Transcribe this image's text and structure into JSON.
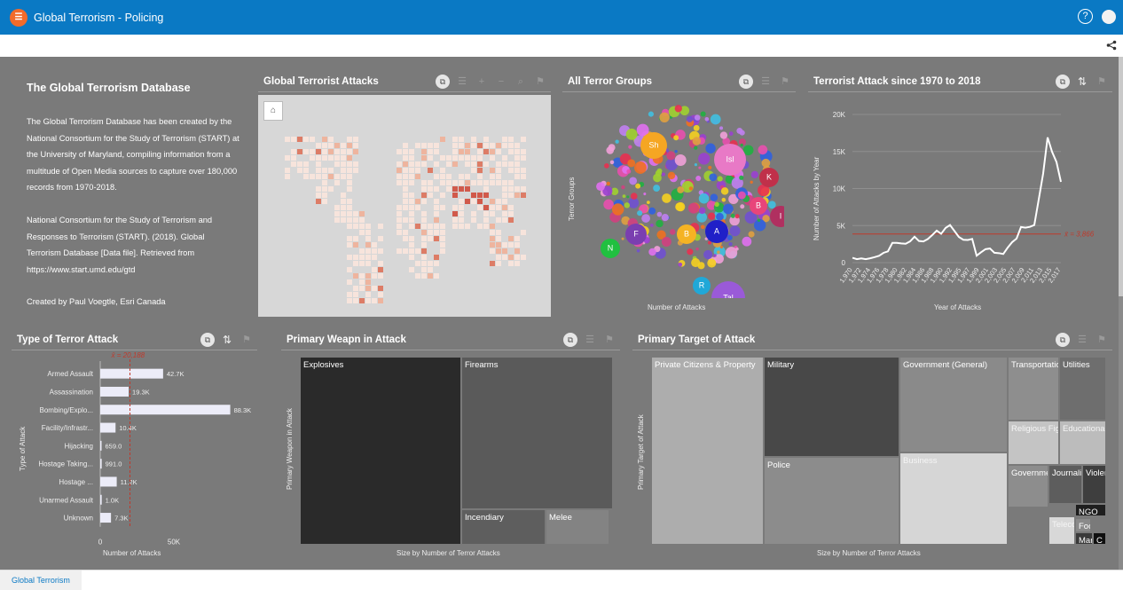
{
  "header": {
    "title": "Global Terrorism - Policing",
    "help": "?"
  },
  "intro": {
    "heading": "The Global Terrorism Database",
    "para1": "The Global Terrorism Database has been created by the National Consortium for the Study of Terrorism (START) at the University of Maryland, compiling information from a multitude of Open Media sources to capture over 180,000 records from 1970-2018.",
    "para2": "National Consortium for the Study of Terrorism and Responses to Terrorism (START). (2018). Global Terrorism Database [Data file]. Retrieved from https://www.start.umd.edu/gtd",
    "para3": "Created by Paul Voegtle, Esri Canada"
  },
  "cards": {
    "map": {
      "title": "Global Terrorist Attacks"
    },
    "groups": {
      "title": "All Terror Groups",
      "y_title": "Terror Groups",
      "x_title": "Number of Attacks"
    },
    "timeline": {
      "title": "Terrorist Attack since 1970 to 2018",
      "y_title": "Number of Attacks by Year",
      "x_title": "Year of Attacks",
      "avg_label": "x̄ = 3,866"
    },
    "attack_type": {
      "title": "Type of Terror Attack",
      "y_title": "Type of Attack",
      "x_title": "Number of Attacks",
      "avg_label": "x̄ = 20,188"
    },
    "weapon": {
      "title": "Primary Weapn in Attack",
      "y_title": "Primary Weapon in Attack",
      "x_title": "Size by Number of Terror Attacks"
    },
    "target": {
      "title": "Primary Target of Attack",
      "y_title": "Primary Target of Attack",
      "x_title": "Size by Number of Terror Attacks"
    }
  },
  "chart_data": [
    {
      "type": "bubble",
      "title": "All Terror Groups",
      "ylabel": "Terror Groups",
      "xlabel": "Number of Attacks",
      "labeled_bubbles": [
        {
          "label": "Sh",
          "color": "#f5a623"
        },
        {
          "label": "Isl",
          "color": "#e879c6"
        },
        {
          "label": "K",
          "color": "#c0304a"
        },
        {
          "label": "B",
          "color": "#e8457a"
        },
        {
          "label": "I",
          "color": "#b03060"
        },
        {
          "label": "F",
          "color": "#7a3fb0"
        },
        {
          "label": "B",
          "color": "#f5b323"
        },
        {
          "label": "A",
          "color": "#2020c8"
        },
        {
          "label": "N",
          "color": "#20c040"
        },
        {
          "label": "R",
          "color": "#20a8d8"
        },
        {
          "label": "Tal",
          "color": "#9a5ad8"
        }
      ]
    },
    {
      "type": "line",
      "title": "Terrorist Attack since 1970 to 2018",
      "xlabel": "Year of Attacks",
      "ylabel": "Number of Attacks by Year",
      "ylim": [
        0,
        20000
      ],
      "yticks": [
        "0",
        "5K",
        "10K",
        "15K",
        "20K"
      ],
      "average": 3866,
      "x": [
        1970,
        1971,
        1972,
        1973,
        1974,
        1975,
        1976,
        1977,
        1978,
        1979,
        1980,
        1981,
        1982,
        1983,
        1984,
        1985,
        1986,
        1987,
        1988,
        1989,
        1990,
        1991,
        1992,
        1994,
        1995,
        1996,
        1997,
        1998,
        1999,
        2000,
        2001,
        2002,
        2003,
        2004,
        2005,
        2006,
        2007,
        2008,
        2009,
        2010,
        2011,
        2012,
        2013,
        2014,
        2015,
        2016,
        2017
      ],
      "y": [
        651,
        471,
        568,
        473,
        581,
        740,
        923,
        1319,
        1526,
        2662,
        2662,
        2586,
        2544,
        2870,
        3495,
        2915,
        2860,
        3183,
        3721,
        4324,
        3887,
        4683,
        5071,
        3456,
        3081,
        3058,
        3197,
        934,
        1395,
        1814,
        1906,
        1333,
        1278,
        1166,
        2017,
        2758,
        3242,
        4805,
        4721,
        4826,
        5076,
        8522,
        12036,
        16903,
        14965,
        13587,
        10900
      ],
      "xticks": [
        "1,970",
        "1,972",
        "1,974",
        "1,976",
        "1,978",
        "1,980",
        "1,982",
        "1,984",
        "1,986",
        "1,988",
        "1,990",
        "1,992",
        "1,995",
        "1,997",
        "1,999",
        "2,001",
        "2,003",
        "2,005",
        "2,007",
        "2,009",
        "2,011",
        "2,013",
        "2,015",
        "2,017"
      ]
    },
    {
      "type": "bar",
      "title": "Type of Terror Attack",
      "ylabel": "Type of Attack",
      "xlabel": "Number of Attacks",
      "categories": [
        "Armed Assault",
        "Assassination",
        "Bombing/Explo...",
        "Facility/Infrastr...",
        "Hijacking",
        "Hostage Taking...",
        "Hostage ...",
        "Unarmed Assault",
        "Unknown"
      ],
      "values": [
        42700,
        19300,
        88300,
        10400,
        659,
        991,
        11200,
        1000,
        7300
      ],
      "value_labels": [
        "42.7K",
        "19.3K",
        "88.3K",
        "10.4K",
        "659.0",
        "991.0",
        "11.2K",
        "1.0K",
        "7.3K"
      ],
      "xlim": [
        0,
        100000
      ],
      "xticks": [
        "0",
        "50K"
      ],
      "average": 20188
    },
    {
      "type": "treemap",
      "title": "Primary Weapn in Attack",
      "cells": [
        {
          "label": "Explosives",
          "color": "#2a2a2a"
        },
        {
          "label": "Firearms",
          "color": "#5a5a5a"
        },
        {
          "label": "Incendiary",
          "color": "#5e5e5e"
        },
        {
          "label": "Melee",
          "color": "#838383"
        }
      ]
    },
    {
      "type": "treemap",
      "title": "Primary Target of Attack",
      "cells": [
        {
          "label": "Private Citizens & Property",
          "color": "#adadad"
        },
        {
          "label": "Military",
          "color": "#484848"
        },
        {
          "label": "Police",
          "color": "#8c8c8c"
        },
        {
          "label": "Government (General)",
          "color": "#8a8a8a"
        },
        {
          "label": "Business",
          "color": "#d6d6d6"
        },
        {
          "label": "Transportatio",
          "color": "#8e8e8e"
        },
        {
          "label": "Utilities",
          "color": "#6e6e6e"
        },
        {
          "label": "Religious Fig",
          "color": "#c4c4c4"
        },
        {
          "label": "Educational",
          "color": "#bcbcbc"
        },
        {
          "label": "Governme",
          "color": "#8d8d8d"
        },
        {
          "label": "Journalis",
          "color": "#5d5d5d"
        },
        {
          "label": "Violer",
          "color": "#3e3e3e"
        },
        {
          "label": "NGO",
          "color": "#1e1e1e"
        },
        {
          "label": "Teleco",
          "color": "#d8d8d8"
        },
        {
          "label": "Foo",
          "color": "#8a8a8a"
        },
        {
          "label": "Mar",
          "color": "#3a3a3a"
        },
        {
          "label": "C",
          "color": "#101010"
        }
      ]
    }
  ],
  "footer": {
    "tab": "Global Terrorism"
  },
  "colors": {
    "header": "#0a79c4",
    "canvas": "#7a7a7a",
    "bar": "#ececf8",
    "avg_line": "#c0392b",
    "line": "#ffffff"
  }
}
